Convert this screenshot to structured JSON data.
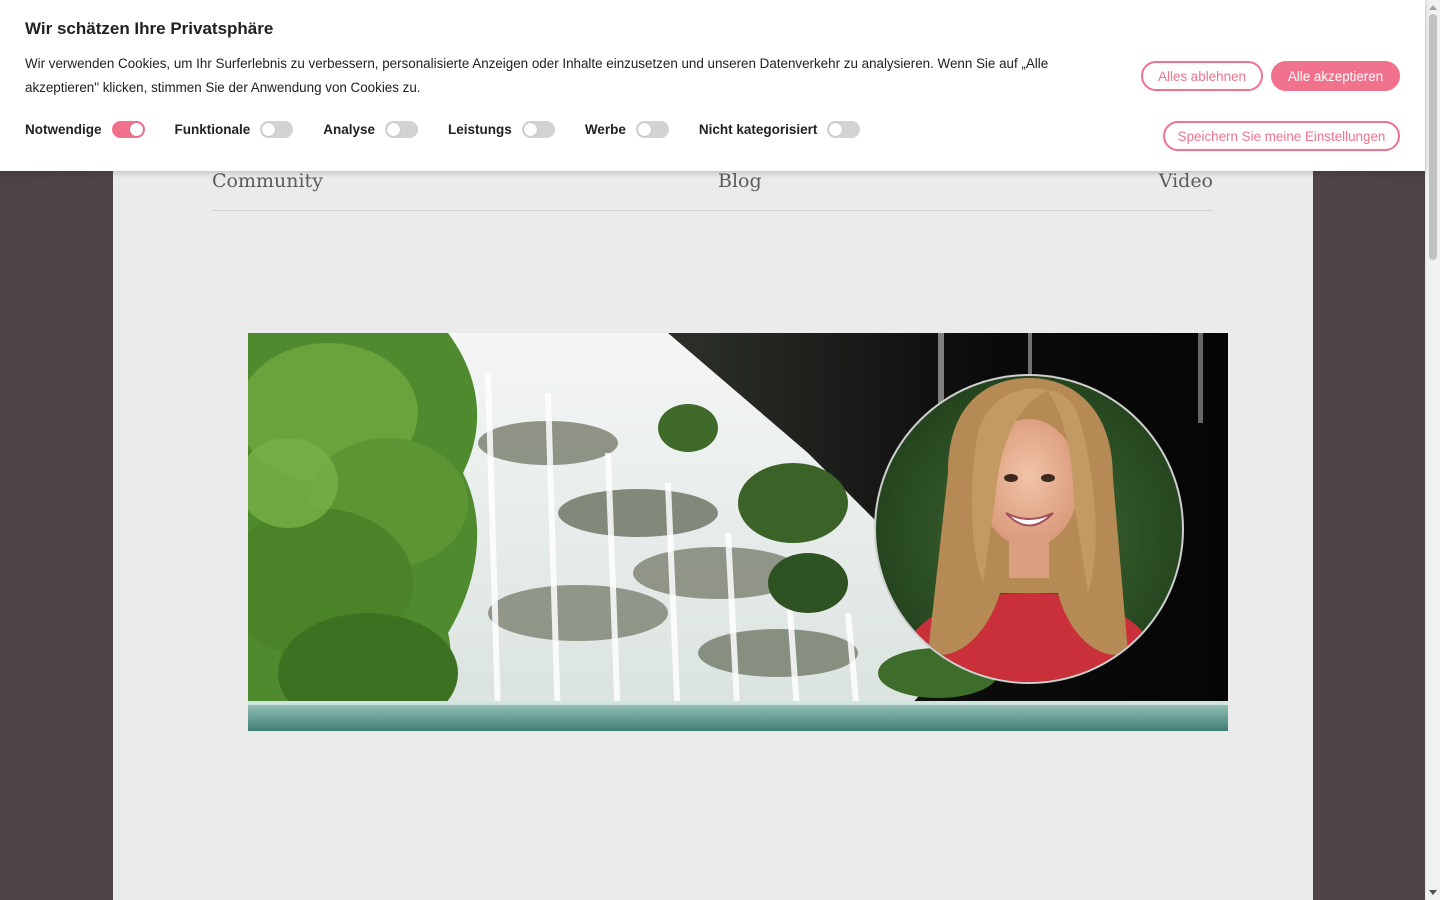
{
  "cookie_banner": {
    "title": "Wir schätzen Ihre Privatsphäre",
    "text": "Wir verwenden Cookies, um Ihr Surferlebnis zu verbessern, personalisierte Anzeigen oder Inhalte einzusetzen und unseren Datenverkehr zu analysieren. Wenn Sie auf „Alle akzeptieren\" klicken, stimmen Sie der Anwendung von Cookies zu.",
    "toggles": [
      {
        "label": "Notwendige",
        "enabled": true
      },
      {
        "label": "Funktionale",
        "enabled": false
      },
      {
        "label": "Analyse",
        "enabled": false
      },
      {
        "label": "Leistungs",
        "enabled": false
      },
      {
        "label": "Werbe",
        "enabled": false
      },
      {
        "label": "Nicht kategorisiert",
        "enabled": false
      }
    ],
    "buttons": {
      "reject": "Alles ablehnen",
      "accept": "Alle akzeptieren",
      "save": "Speichern Sie meine Einstellungen"
    },
    "accent_color": "#f0728c"
  },
  "nav": {
    "items": [
      "Community",
      "Blog",
      "Video"
    ]
  },
  "colors": {
    "page_background": "#52484d",
    "content_background": "#ebebeb"
  }
}
